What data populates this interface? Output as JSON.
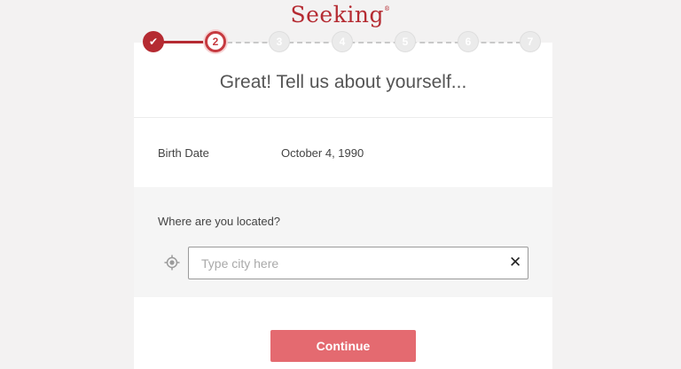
{
  "brand": {
    "logo_text": "Seeking",
    "logo_mark": "®",
    "color": "#b52b32"
  },
  "stepper": {
    "steps": [
      {
        "label": "✔",
        "state": "done"
      },
      {
        "label": "2",
        "state": "current"
      },
      {
        "label": "3",
        "state": "future"
      },
      {
        "label": "4",
        "state": "future"
      },
      {
        "label": "5",
        "state": "future"
      },
      {
        "label": "6",
        "state": "future"
      },
      {
        "label": "7",
        "state": "future"
      }
    ]
  },
  "form": {
    "title": "Great! Tell us about yourself...",
    "birth_date_label": "Birth Date",
    "birth_date_value": "October 4, 1990",
    "location_label": "Where are you located?",
    "location_icon": "location-target-icon",
    "city_value": "",
    "city_placeholder": "Type city here",
    "clear_icon": "close-icon",
    "clear_symbol": "✕",
    "continue_label": "Continue",
    "continue_color": "#e46a70"
  }
}
